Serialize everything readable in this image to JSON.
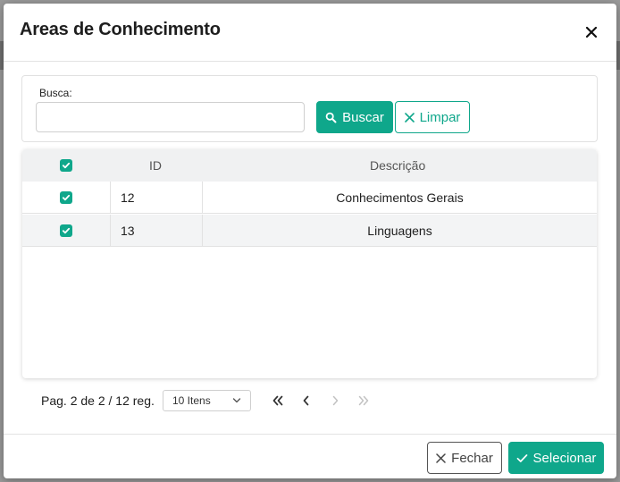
{
  "modal": {
    "title": "Areas de Conhecimento"
  },
  "search": {
    "label": "Busca:",
    "value": "",
    "placeholder": "",
    "buscar_label": "Buscar",
    "limpar_label": "Limpar"
  },
  "table": {
    "columns": [
      "ID",
      "Descrição"
    ],
    "rows": [
      {
        "id": "12",
        "descricao": "Conhecimentos Gerais",
        "checked": true
      },
      {
        "id": "13",
        "descricao": "Linguagens",
        "checked": true
      }
    ]
  },
  "pager": {
    "summary": "Pag. 2 de 2 / 12 reg.",
    "page_size": "10 Itens"
  },
  "footer": {
    "fechar_label": "Fechar",
    "selecionar_label": "Selecionar"
  },
  "colors": {
    "accent": "#0fa78b",
    "border": "#e2e2e2"
  },
  "icons": [
    "close-icon",
    "search-icon",
    "clear-icon",
    "check-icon",
    "chevron-down-icon",
    "first-page-icon",
    "prev-page-icon",
    "next-page-icon",
    "last-page-icon"
  ]
}
